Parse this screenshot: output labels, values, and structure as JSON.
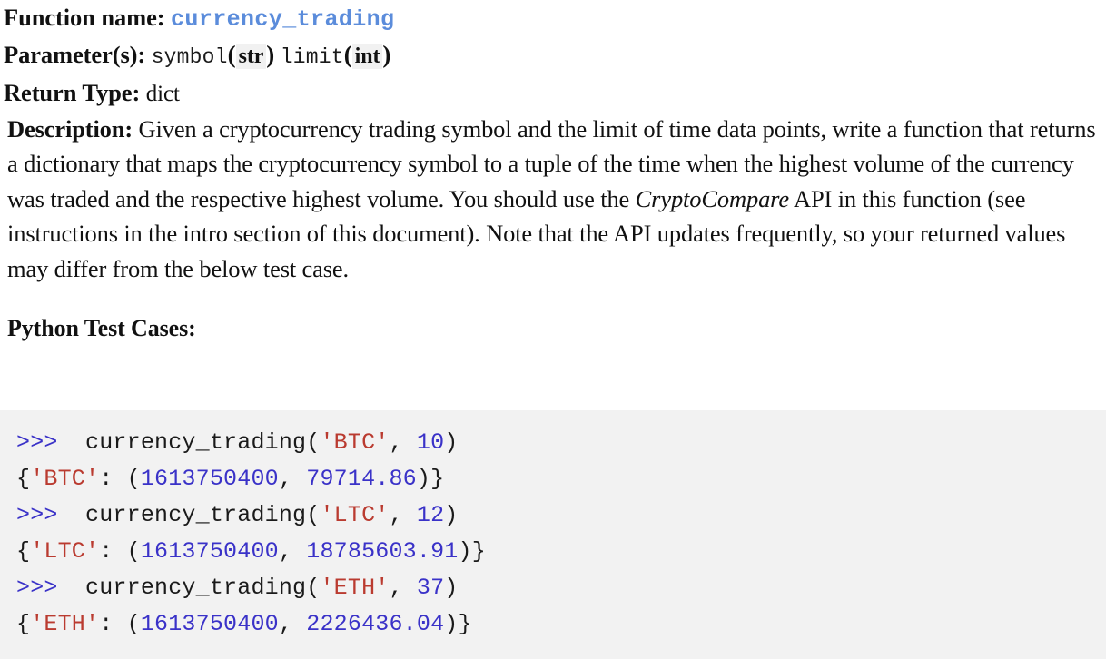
{
  "spec": {
    "function_name_label": "Function name:",
    "function_name": "currency_trading",
    "parameters_label": "Parameter(s):",
    "parameters": [
      {
        "name": "symbol",
        "open_paren": "(",
        "type": "str",
        "close_paren": ")"
      },
      {
        "name": "limit",
        "open_paren": "(",
        "type": "int",
        "close_paren": ")"
      }
    ],
    "return_type_label": "Return Type:",
    "return_type": "dict",
    "description_label": "Description:",
    "description_part1": " Given a cryptocurrency trading symbol and the limit of time data points, write a function that returns a dictionary that maps the cryptocurrency symbol to a tuple of the time when the highest volume of the currency was traded and the respective highest volume. You should use the ",
    "description_emphasis": "CryptoCompare",
    "description_part2": " API in this function (see instructions in the intro section of this document). Note that the API updates frequently, so your returned values may differ from the below test case."
  },
  "test_cases": {
    "heading": "Python Test Cases:",
    "lines": [
      {
        "prompt": ">>>",
        "segments": [
          {
            "text": "  currency_trading(",
            "type": "plain"
          },
          {
            "text": "'BTC'",
            "type": "str"
          },
          {
            "text": ", ",
            "type": "plain"
          },
          {
            "text": "10",
            "type": "num"
          },
          {
            "text": ")",
            "type": "plain"
          }
        ]
      },
      {
        "prompt": "",
        "segments": [
          {
            "text": "{",
            "type": "plain"
          },
          {
            "text": "'BTC'",
            "type": "str"
          },
          {
            "text": ": (",
            "type": "plain"
          },
          {
            "text": "1613750400",
            "type": "num"
          },
          {
            "text": ", ",
            "type": "plain"
          },
          {
            "text": "79714.86",
            "type": "num"
          },
          {
            "text": ")}",
            "type": "plain"
          }
        ]
      },
      {
        "prompt": ">>>",
        "segments": [
          {
            "text": "  currency_trading(",
            "type": "plain"
          },
          {
            "text": "'LTC'",
            "type": "str"
          },
          {
            "text": ", ",
            "type": "plain"
          },
          {
            "text": "12",
            "type": "num"
          },
          {
            "text": ")",
            "type": "plain"
          }
        ]
      },
      {
        "prompt": "",
        "segments": [
          {
            "text": "{",
            "type": "plain"
          },
          {
            "text": "'LTC'",
            "type": "str"
          },
          {
            "text": ": (",
            "type": "plain"
          },
          {
            "text": "1613750400",
            "type": "num"
          },
          {
            "text": ", ",
            "type": "plain"
          },
          {
            "text": "18785603.91",
            "type": "num"
          },
          {
            "text": ")}",
            "type": "plain"
          }
        ]
      },
      {
        "prompt": ">>>",
        "segments": [
          {
            "text": "  currency_trading(",
            "type": "plain"
          },
          {
            "text": "'ETH'",
            "type": "str"
          },
          {
            "text": ", ",
            "type": "plain"
          },
          {
            "text": "37",
            "type": "num"
          },
          {
            "text": ")",
            "type": "plain"
          }
        ]
      },
      {
        "prompt": "",
        "segments": [
          {
            "text": "{",
            "type": "plain"
          },
          {
            "text": "'ETH'",
            "type": "str"
          },
          {
            "text": ": (",
            "type": "plain"
          },
          {
            "text": "1613750400",
            "type": "num"
          },
          {
            "text": ", ",
            "type": "plain"
          },
          {
            "text": "2226436.04",
            "type": "num"
          },
          {
            "text": ")}",
            "type": "plain"
          }
        ]
      }
    ]
  },
  "colors": {
    "function_name": "#5b8cdb",
    "code_background": "#f2f2f2",
    "string_literal": "#ba3b30",
    "number_literal": "#3a32c8",
    "prompt": "#3a32c8",
    "type_chip_background": "#f1f1f1"
  }
}
